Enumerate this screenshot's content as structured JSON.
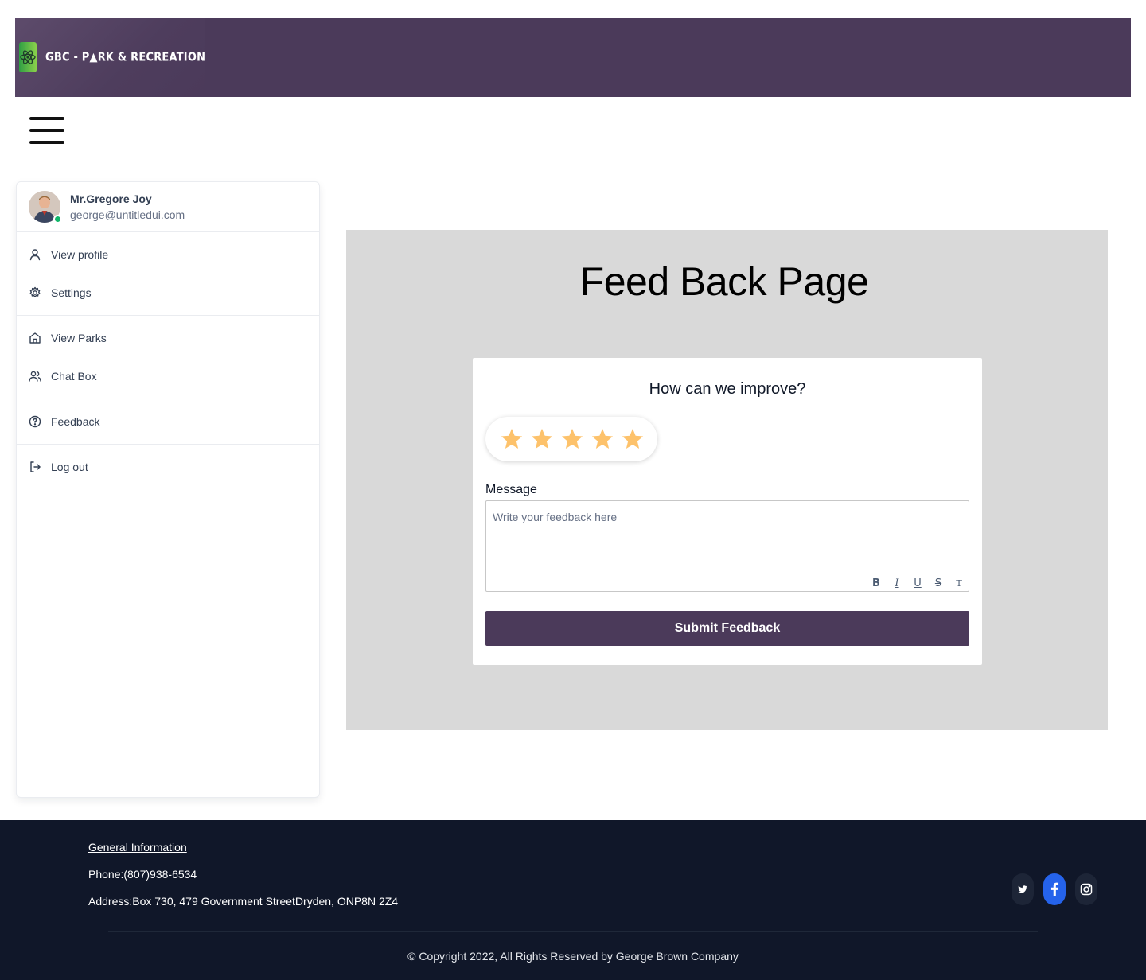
{
  "header": {
    "brand_text": "GBC - P▲RK & RECREATION",
    "colors": {
      "topbar": "#4b3a5a",
      "logo": "#6cc04a"
    }
  },
  "sidebar": {
    "user": {
      "name": "Mr.Gregore Joy",
      "email": "george@untitledui.com",
      "status": "online"
    },
    "groups": [
      [
        {
          "label": "View profile",
          "icon": "user-icon"
        },
        {
          "label": "Settings",
          "icon": "gear-icon"
        }
      ],
      [
        {
          "label": "View Parks",
          "icon": "home-icon"
        },
        {
          "label": "Chat Box",
          "icon": "users-icon"
        }
      ],
      [
        {
          "label": "Feedback",
          "icon": "help-circle-icon"
        }
      ],
      [
        {
          "label": "Log out",
          "icon": "logout-icon"
        }
      ]
    ]
  },
  "main": {
    "title": "Feed Back Page",
    "card": {
      "question": "How can we improve?",
      "rating": {
        "value": 5,
        "max": 5,
        "color": "#fdc26b"
      },
      "message_label": "Message",
      "message_placeholder": "Write your feedback here",
      "message_value": "",
      "format_tools": [
        "B",
        "I",
        "U",
        "S",
        "T"
      ],
      "submit_label": "Submit Feedback"
    }
  },
  "footer": {
    "general_info_label": "General Information",
    "phone": "Phone:(807)938-6534",
    "address": "Address:Box 730, 479 Government StreetDryden, ONP8N 2Z4",
    "socials": [
      "twitter-icon",
      "facebook-icon",
      "instagram-icon"
    ],
    "copyright": "© Copyright 2022, All Rights Reserved by George Brown Company"
  }
}
